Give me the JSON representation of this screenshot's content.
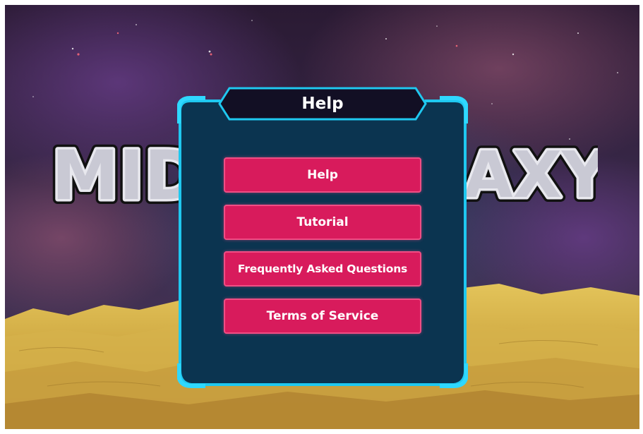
{
  "dialog": {
    "title": "Help"
  },
  "menu": {
    "items": [
      {
        "label": "Help"
      },
      {
        "label": "Tutorial"
      },
      {
        "label": "Frequently Asked Questions"
      },
      {
        "label": "Terms of Service"
      }
    ]
  },
  "background_logo": {
    "text": "MIDNIGHT GALAXY",
    "visible_fragments": [
      "MID",
      "AXY"
    ]
  },
  "colors": {
    "panel_fill": "#0b3450",
    "panel_border": "#1fc8f0",
    "title_bar_fill": "#120f24",
    "button_fill": "#d81b5c",
    "button_border": "#f04d84",
    "sand": "#d4b146"
  }
}
